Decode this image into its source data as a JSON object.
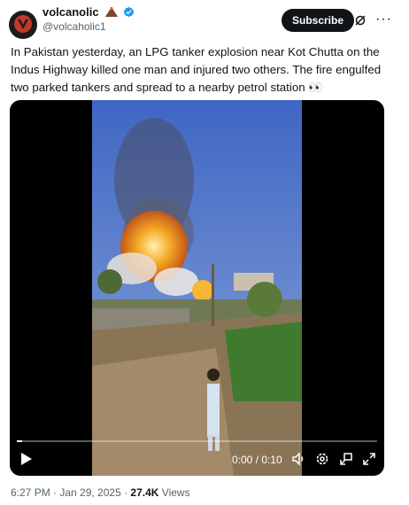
{
  "author": {
    "display_name": "volcanolic",
    "handle": "@volcaholic1",
    "badge_icon": "volcano-icon",
    "verified_icon": "verified-badge-icon"
  },
  "header_actions": {
    "subscribe_label": "Subscribe",
    "grok_icon": "grok-icon",
    "more_icon": "more-options-icon"
  },
  "tweet": {
    "text": "In Pakistan yesterday, an LPG tanker explosion near Kot Chutta on the Indus Highway killed one man and injured two others. The fire engulfed two parked tankers and spread to a nearby petrol station 👀"
  },
  "video": {
    "time": "0:00 / 0:10",
    "progress": 0.015,
    "controls": [
      "play-icon",
      "volume-icon",
      "settings-icon",
      "picture-in-picture-icon",
      "fullscreen-icon"
    ]
  },
  "meta": {
    "timestamp": "6:27 PM · Jan 29, 2025 · ",
    "views_count": "27.4K",
    "views_label": " Views"
  },
  "colors": {
    "primary_text": "#0f1419",
    "secondary_text": "#536471",
    "verified_blue": "#1d9bf0"
  }
}
